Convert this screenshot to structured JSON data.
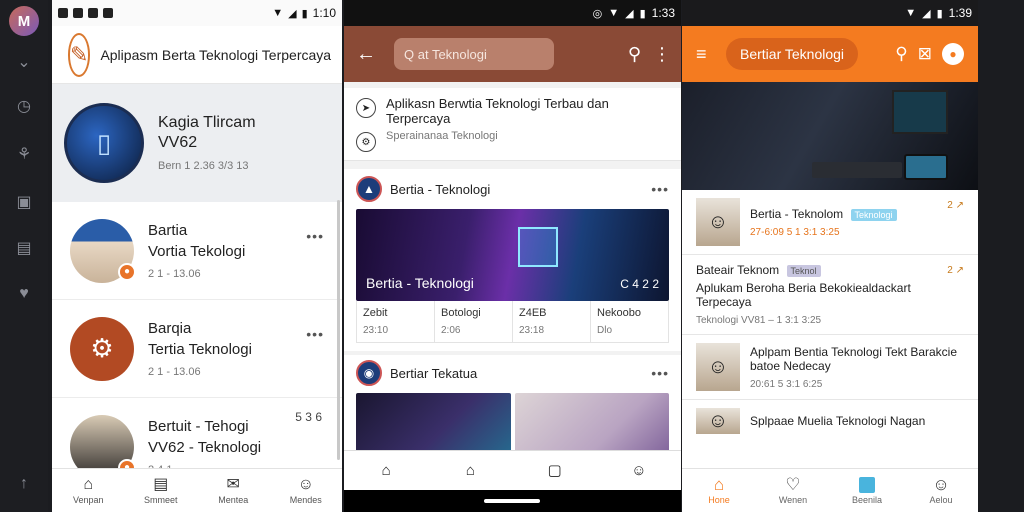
{
  "rail": {
    "logo_letter": "M",
    "icons": [
      "chevron-down-icon",
      "clock-icon",
      "plant-icon",
      "document-icon",
      "image-icon",
      "heart-icon",
      "up-arrow-icon"
    ]
  },
  "phone1": {
    "status": {
      "time": "1:10"
    },
    "app_title": "Aplipasm Berta Teknologi Terpercaya",
    "featured": {
      "line1": "Kagia Tlircam",
      "line2": "VV62",
      "meta": "Bern 1 2.36 3/3 13"
    },
    "items": [
      {
        "title": "Bartia",
        "subtitle": "Vortia Tekologi",
        "meta": "2 1 - 13.06"
      },
      {
        "title": "Barqia",
        "subtitle": "Tertia Teknologi",
        "meta": "2 1 - 13.06"
      },
      {
        "title": "Bertuit - Tehogi",
        "subtitle": "VV62 - Teknologi",
        "meta": "2 4 1",
        "count": "5 3 6"
      }
    ],
    "nav": [
      "Venpan",
      "Smmeet",
      "Mentea",
      "Mendes"
    ]
  },
  "phone2": {
    "status": {
      "time": "1:33"
    },
    "search_placeholder": "Q   at Teknologi",
    "header": {
      "title": "Aplikasn Berwtia Teknologi Terbau dan Terpercaya",
      "subtitle": "Sperainanaa Teknologi"
    },
    "card1": {
      "source": "Bertia - Teknologi",
      "caption": "Bertia - Teknologi",
      "caption_right": "C 4 2 2",
      "stats": [
        {
          "a": "Zebit",
          "b": "23:10"
        },
        {
          "a": "Botologi",
          "b": "2:06"
        },
        {
          "a": "Z4EB",
          "b": "23:18"
        },
        {
          "a": "Nekoobo",
          "b": "Dlo"
        }
      ]
    },
    "card2": {
      "source": "Bertiar Tekatua"
    }
  },
  "phone3": {
    "status": {
      "time": "1:39"
    },
    "pill": "Bertiar Teknologi",
    "items": [
      {
        "title": "Bertia - Teknolom",
        "tag": "Teknologi",
        "meta": "27-6:09 5 1 3:1 3:25",
        "corner": "2 ↗"
      },
      {
        "title": "Bateair Teknom",
        "tag": "Teknol",
        "body": "Aplukam Beroha Beria Bekokiealdackart Terpecaya",
        "meta": "Teknologi VV81 – 1 3:1 3:25",
        "corner": "2 ↗"
      },
      {
        "title": "Aplpam Bentia Teknologi Tekt Barakcie batoe Nedecay",
        "meta": "20:61 5 3:1 6:25"
      },
      {
        "title": "Splpaae Muelia Teknologi Nagan"
      }
    ],
    "nav": [
      "Hone",
      "Wenen",
      "Beenila",
      "Aelou"
    ]
  },
  "colors": {
    "phone2_appbar": "#8a4a36",
    "phone3_appbar": "#f47b20",
    "accent_orange": "#e8742a"
  }
}
